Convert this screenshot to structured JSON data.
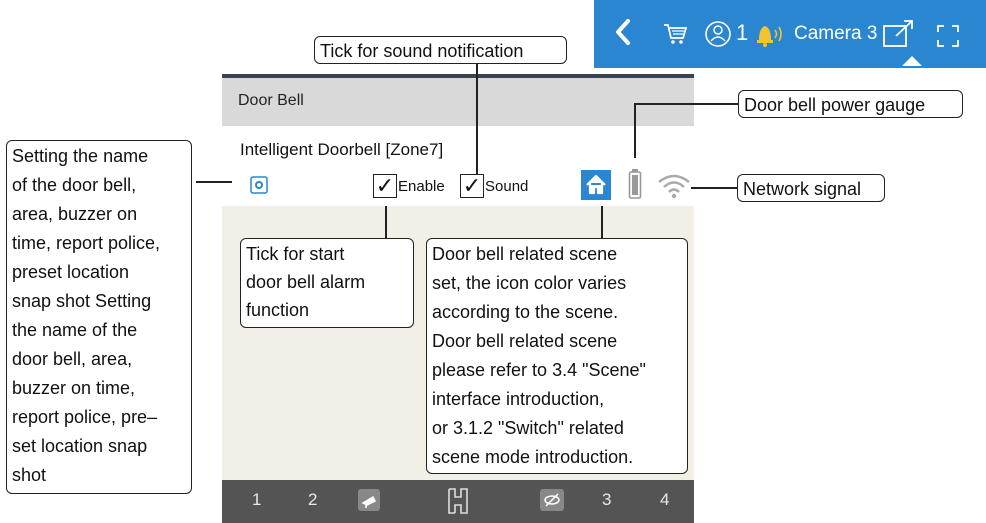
{
  "topbar": {
    "cart_icon": "cart-icon",
    "person_count": "1",
    "camera_label": "Camera 3",
    "colors": {
      "background": "#2a86d0",
      "bell": "#f4c430"
    }
  },
  "app": {
    "header_title": "Door Bell",
    "device_name": "Intelligent Doorbell [Zone7]",
    "enable_label": "Enable",
    "sound_label": "Sound",
    "footer_items": [
      "1",
      "2",
      "3",
      "4"
    ]
  },
  "callouts": {
    "sound": "Tick for sound notification",
    "power_gauge": "Door bell power gauge",
    "network": "Network signal",
    "left_lines": [
      "Setting the name",
      "of the door bell,",
      "area, buzzer on",
      "time, report police,",
      "preset location",
      "snap shot Setting",
      "the name of the",
      "door bell, area,",
      "buzzer on time,",
      "report police, pre–",
      "set location snap",
      "shot"
    ],
    "enable_lines": [
      "Tick for start",
      "door bell alarm",
      "function"
    ],
    "scene_lines": [
      "Door bell related scene",
      "set, the icon color varies",
      "according to the scene.",
      "Door bell related scene",
      "please refer to 3.4 \"Scene\"",
      "interface introduction,",
      "or 3.1.2 \"Switch\" related",
      "scene mode introduction."
    ]
  }
}
